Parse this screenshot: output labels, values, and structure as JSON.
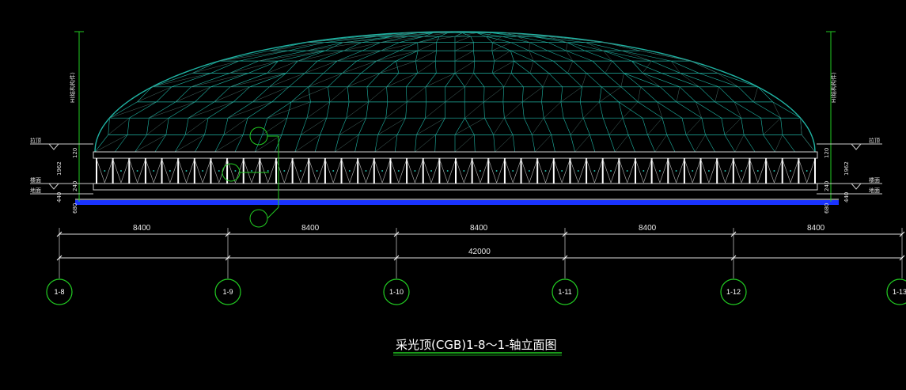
{
  "drawing": {
    "title": "采光顶(CGB)1-8～1-轴立面图",
    "colors": {
      "background": "#000000",
      "dome_mesh": "#1fb3a3",
      "dome_inner": "#4a6b66",
      "dimension": "#ffffff",
      "axis_bubble": "#22cc22",
      "ring_beam": "#1a33ff",
      "column": "#ffffff",
      "title_underline": "#22cc22"
    },
    "span_dimensions": [
      "8400",
      "8400",
      "8400",
      "8400",
      "8400"
    ],
    "total_dimension": "42000",
    "axis_labels": [
      "1-8",
      "1-9",
      "1-10",
      "1-11",
      "1-12",
      "1-13"
    ],
    "left_side": {
      "vertical_label": "H(结构构件)",
      "level_labels": [
        "拉顶",
        "楼面",
        "地面"
      ],
      "small_dims": [
        "120",
        "1962",
        "240",
        "440",
        "680"
      ]
    },
    "right_side": {
      "vertical_label": "H(结构构件)",
      "level_labels": [
        "拉顶",
        "楼面",
        "地面"
      ],
      "small_dims": [
        "120",
        "1962",
        "240",
        "440",
        "680"
      ]
    }
  }
}
